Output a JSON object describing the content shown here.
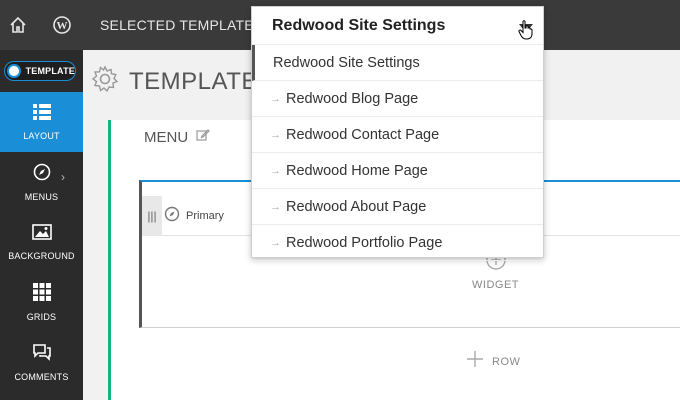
{
  "topbar": {
    "title": "SELECTED TEMPLATE"
  },
  "sidebar": {
    "toggle_label": "TEMPLATE",
    "items": [
      {
        "label": "LAYOUT",
        "icon": "layout-icon",
        "active": true
      },
      {
        "label": "MENUS",
        "icon": "compass-icon",
        "active": false
      },
      {
        "label": "BACKGROUND",
        "icon": "image-icon",
        "active": false
      },
      {
        "label": "GRIDS",
        "icon": "grid-icon",
        "active": false
      },
      {
        "label": "COMMENTS",
        "icon": "comments-icon",
        "active": false
      }
    ]
  },
  "main": {
    "template_title": "TEMPLATE",
    "menu_label": "MENU",
    "widget_name": "Primary",
    "add_widget_label": "WIDGET",
    "add_row_label": "ROW"
  },
  "dropdown": {
    "current": "Redwood Site Settings",
    "options": [
      "Redwood Site Settings",
      "Redwood Blog Page",
      "Redwood Contact Page",
      "Redwood Home Page",
      "Redwood About Page",
      "Redwood Portfolio Page"
    ]
  },
  "colors": {
    "accent": "#1a8ed6",
    "green": "#18b37a",
    "topbar": "#3a3a3a",
    "sidebar": "#2b2b2b"
  }
}
